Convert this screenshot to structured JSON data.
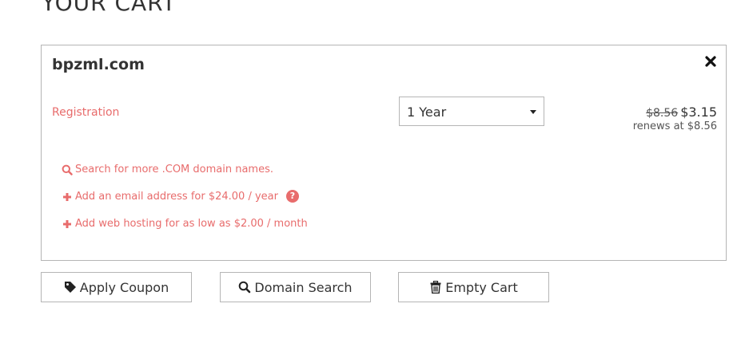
{
  "page": {
    "title": "YOUR CART"
  },
  "cart_item": {
    "domain": "bpzml.com",
    "registration_label": "Registration",
    "term_selected": "1 Year",
    "old_price": "$8.56",
    "price": "$3.15",
    "renews_text": "renews at $8.56",
    "remove_icon": "close-icon"
  },
  "addons": [
    {
      "icon": "search-icon",
      "label": "Search for more .COM domain names."
    },
    {
      "icon": "plus-icon",
      "label": "Add an email address for $24.00 / year"
    },
    {
      "icon": "plus-icon",
      "label": "Add web hosting for as low as $2.00 / month"
    }
  ],
  "actions": {
    "apply_coupon": "Apply Coupon",
    "domain_search": "Domain Search",
    "empty_cart": "Empty Cart"
  },
  "colors": {
    "accent": "#e86c6c",
    "border": "#b5b5b5",
    "text": "#333333"
  }
}
